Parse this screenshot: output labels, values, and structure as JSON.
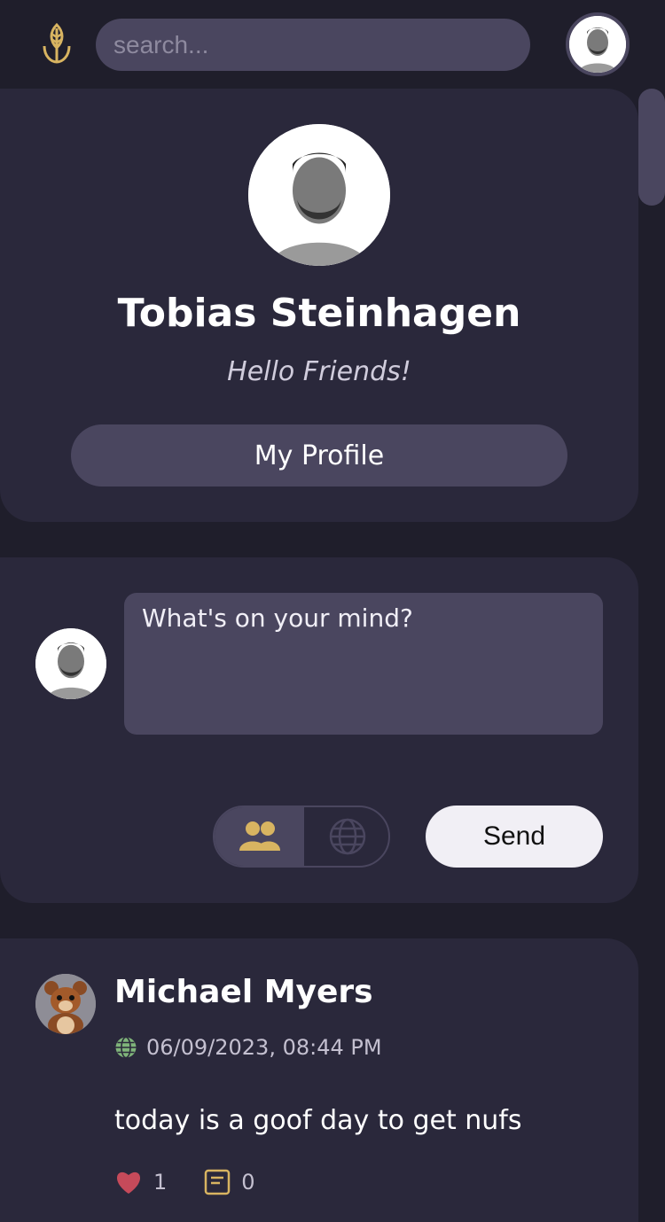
{
  "search": {
    "placeholder": "search..."
  },
  "profile": {
    "name": "Tobias Steinhagen",
    "status": "Hello Friends!",
    "button_label": "My Profile"
  },
  "composer": {
    "placeholder": "What's on your mind?",
    "visibility_options": [
      "friends",
      "public"
    ],
    "selected_visibility": "friends",
    "send_label": "Send"
  },
  "post": {
    "author": "Michael Myers",
    "date": "06/09/2023, 08:44 PM",
    "visibility_icon": "globe-icon",
    "body": "today is a goof day to get nufs",
    "likes": "1",
    "comments": "0"
  },
  "colors": {
    "accent": "#d8b461",
    "background": "#1f1e2b",
    "card": "#2a283b",
    "input": "#4a465f"
  }
}
